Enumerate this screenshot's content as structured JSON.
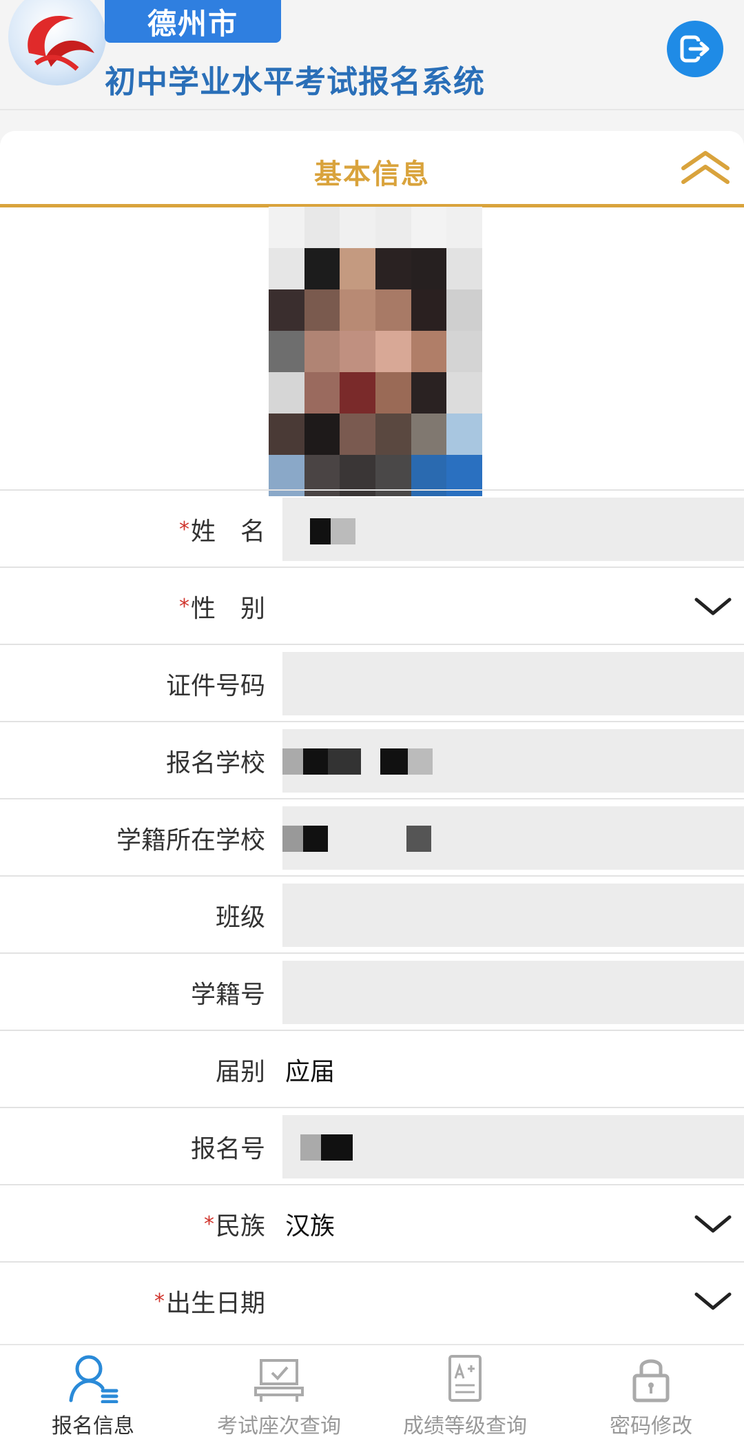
{
  "header": {
    "city": "德州市",
    "title": "初中学业水平考试报名系统",
    "logout_icon": "logout-icon"
  },
  "section": {
    "title": "基本信息",
    "collapse_icon": "chevron-up-icon"
  },
  "form": {
    "rows": [
      {
        "label": "姓　名",
        "required": true,
        "value": "",
        "dropdown": false
      },
      {
        "label": "性　别",
        "required": true,
        "value": "",
        "dropdown": true
      },
      {
        "label": "证件号码",
        "required": false,
        "value": "",
        "dropdown": false
      },
      {
        "label": "报名学校",
        "required": false,
        "value": "",
        "dropdown": false
      },
      {
        "label": "学籍所在学校",
        "required": false,
        "value": "",
        "dropdown": false
      },
      {
        "label": "班级",
        "required": false,
        "value": "",
        "dropdown": false
      },
      {
        "label": "学籍号",
        "required": false,
        "value": "",
        "dropdown": false
      },
      {
        "label": "届别",
        "required": false,
        "value": "应届",
        "dropdown": false
      },
      {
        "label": "报名号",
        "required": false,
        "value": "",
        "dropdown": false
      },
      {
        "label": "民族",
        "required": true,
        "value": "汉族",
        "dropdown": true
      },
      {
        "label": "出生日期",
        "required": true,
        "value": "",
        "dropdown": true
      }
    ],
    "required_mark": "*"
  },
  "nav": {
    "items": [
      {
        "label": "报名信息",
        "icon": "user-list-icon",
        "active": true
      },
      {
        "label": "考试座次查询",
        "icon": "desk-icon",
        "active": false
      },
      {
        "label": "成绩等级查询",
        "icon": "grade-sheet-icon",
        "active": false
      },
      {
        "label": "密码修改",
        "icon": "lock-icon",
        "active": false
      }
    ]
  },
  "colors": {
    "accent_gold": "#d9a33c",
    "brand_blue": "#2f7fe0",
    "title_blue": "#2a6fb8",
    "required_red": "#d0342c"
  }
}
